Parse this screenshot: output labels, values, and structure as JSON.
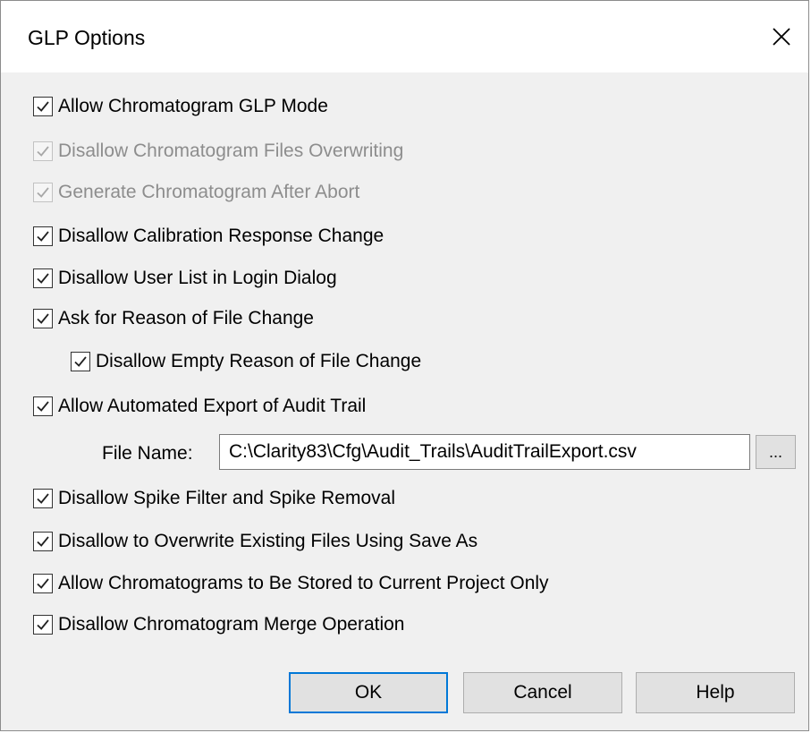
{
  "window": {
    "title": "GLP Options"
  },
  "options": [
    {
      "label": "Allow Chromatogram GLP Mode",
      "checked": true,
      "enabled": true
    },
    {
      "label": "Disallow Chromatogram Files Overwriting",
      "checked": true,
      "enabled": false
    },
    {
      "label": "Generate Chromatogram After Abort",
      "checked": true,
      "enabled": false
    },
    {
      "label": "Disallow Calibration Response Change",
      "checked": true,
      "enabled": true
    },
    {
      "label": "Disallow User List in Login Dialog",
      "checked": true,
      "enabled": true
    },
    {
      "label": "Ask for Reason of File Change",
      "checked": true,
      "enabled": true
    },
    {
      "label": "Disallow Empty Reason of File Change",
      "checked": true,
      "enabled": true
    },
    {
      "label": "Allow Automated Export of Audit Trail",
      "checked": true,
      "enabled": true
    },
    {
      "label": "Disallow Spike Filter and Spike Removal",
      "checked": true,
      "enabled": true
    },
    {
      "label": "Disallow to Overwrite Existing Files Using Save As",
      "checked": true,
      "enabled": true
    },
    {
      "label": "Allow Chromatograms to Be Stored to Current Project Only",
      "checked": true,
      "enabled": true
    },
    {
      "label": "Disallow Chromatogram Merge Operation",
      "checked": true,
      "enabled": true
    }
  ],
  "file_name": {
    "label": "File Name:",
    "value": "C:\\Clarity83\\Cfg\\Audit_Trails\\AuditTrailExport.csv",
    "browse_label": "..."
  },
  "buttons": {
    "ok": "OK",
    "cancel": "Cancel",
    "help": "Help"
  },
  "colors": {
    "accent": "#0078d7",
    "disabled_text": "#8d8d8d"
  }
}
